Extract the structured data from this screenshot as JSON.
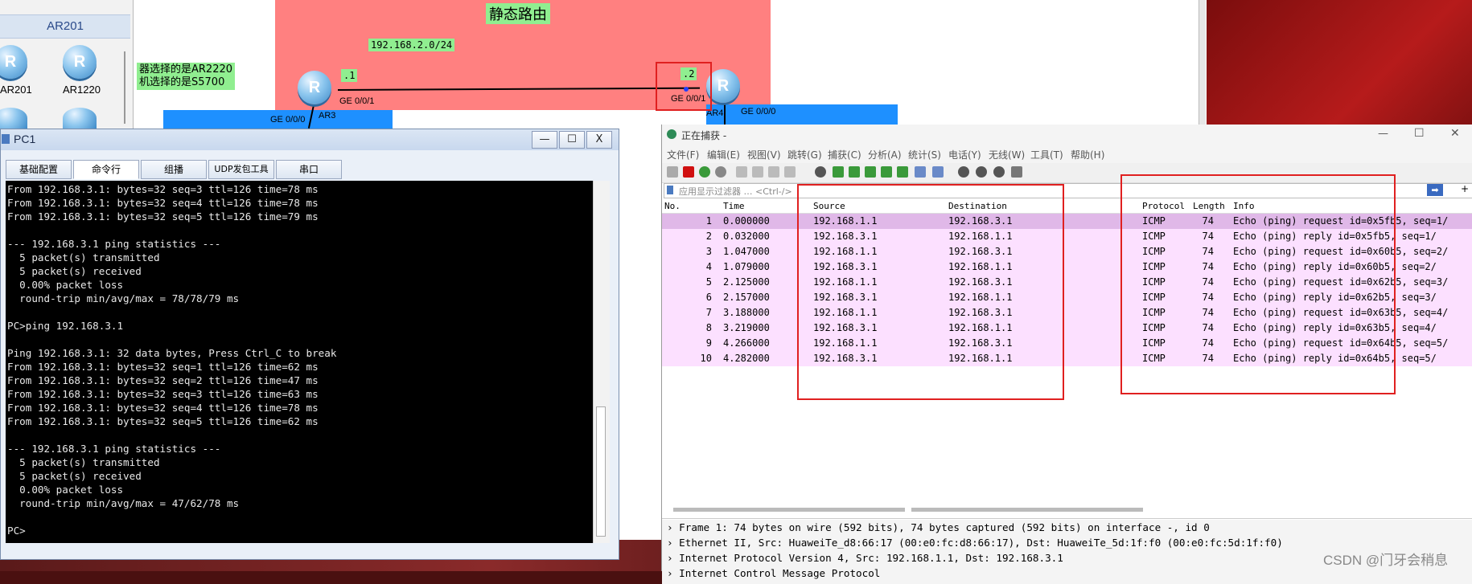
{
  "topology": {
    "device_panel_title": "AR201",
    "devices": [
      {
        "label": "AR201",
        "icon_letter": "R"
      },
      {
        "label": "AR1220",
        "icon_letter": "R"
      }
    ],
    "zone_title": "静态路由",
    "subnet_label": "192.168.2.0/24",
    "note_line1": "器选择的是AR2220",
    "note_line2": "机选择的是S5700",
    "ar3": {
      "label": "AR3",
      "icon_letter": "R",
      "port_right": "GE 0/0/1",
      "port_bottom": "GE 0/0/0",
      "ip_suffix": ".1"
    },
    "ar4": {
      "label": "AR4",
      "icon_letter": "R",
      "port_left": "GE 0/0/1",
      "port_bottom": "GE 0/0/0",
      "ip_suffix": ".2"
    },
    "colors": {
      "zone": "#ff8080",
      "link_area": "#1e90ff",
      "label_bg": "#90ee90",
      "highlight": "#e02020"
    }
  },
  "pc1": {
    "title": "PC1",
    "buttons": {
      "minimize": "—",
      "maximize": "☐",
      "close": "X"
    },
    "tabs": [
      "基础配置",
      "命令行",
      "组播",
      "UDP发包工具",
      "串口"
    ],
    "active_tab": 1,
    "console_text": "From 192.168.3.1: bytes=32 seq=3 ttl=126 time=78 ms\nFrom 192.168.3.1: bytes=32 seq=4 ttl=126 time=78 ms\nFrom 192.168.3.1: bytes=32 seq=5 ttl=126 time=79 ms\n\n--- 192.168.3.1 ping statistics ---\n  5 packet(s) transmitted\n  5 packet(s) received\n  0.00% packet loss\n  round-trip min/avg/max = 78/78/79 ms\n\nPC>ping 192.168.3.1\n\nPing 192.168.3.1: 32 data bytes, Press Ctrl_C to break\nFrom 192.168.3.1: bytes=32 seq=1 ttl=126 time=62 ms\nFrom 192.168.3.1: bytes=32 seq=2 ttl=126 time=47 ms\nFrom 192.168.3.1: bytes=32 seq=3 ttl=126 time=63 ms\nFrom 192.168.3.1: bytes=32 seq=4 ttl=126 time=78 ms\nFrom 192.168.3.1: bytes=32 seq=5 ttl=126 time=62 ms\n\n--- 192.168.3.1 ping statistics ---\n  5 packet(s) transmitted\n  5 packet(s) received\n  0.00% packet loss\n  round-trip min/avg/max = 47/62/78 ms\n\nPC>"
  },
  "wireshark": {
    "title": "正在捕获 -",
    "window_buttons": {
      "minimize": "—",
      "maximize": "☐",
      "close": "✕"
    },
    "menu": [
      "文件(F)",
      "编辑(E)",
      "视图(V)",
      "跳转(G)",
      "捕获(C)",
      "分析(A)",
      "统计(S)",
      "电话(Y)",
      "无线(W)",
      "工具(T)",
      "帮助(H)"
    ],
    "filter_placeholder": "应用显示过滤器 … <Ctrl-/>",
    "filter_apply": "➡",
    "filter_add": "+",
    "columns": [
      "No.",
      "Time",
      "Source",
      "Destination",
      "Protocol",
      "Length",
      "Info"
    ],
    "packets": [
      {
        "no": "1",
        "time": "0.000000",
        "src": "192.168.1.1",
        "dst": "192.168.3.1",
        "proto": "ICMP",
        "len": "74",
        "info": "Echo (ping) request  id=0x5fb5, seq=1/"
      },
      {
        "no": "2",
        "time": "0.032000",
        "src": "192.168.3.1",
        "dst": "192.168.1.1",
        "proto": "ICMP",
        "len": "74",
        "info": "Echo (ping) reply    id=0x5fb5, seq=1/"
      },
      {
        "no": "3",
        "time": "1.047000",
        "src": "192.168.1.1",
        "dst": "192.168.3.1",
        "proto": "ICMP",
        "len": "74",
        "info": "Echo (ping) request  id=0x60b5, seq=2/"
      },
      {
        "no": "4",
        "time": "1.079000",
        "src": "192.168.3.1",
        "dst": "192.168.1.1",
        "proto": "ICMP",
        "len": "74",
        "info": "Echo (ping) reply    id=0x60b5, seq=2/"
      },
      {
        "no": "5",
        "time": "2.125000",
        "src": "192.168.1.1",
        "dst": "192.168.3.1",
        "proto": "ICMP",
        "len": "74",
        "info": "Echo (ping) request  id=0x62b5, seq=3/"
      },
      {
        "no": "6",
        "time": "2.157000",
        "src": "192.168.3.1",
        "dst": "192.168.1.1",
        "proto": "ICMP",
        "len": "74",
        "info": "Echo (ping) reply    id=0x62b5, seq=3/"
      },
      {
        "no": "7",
        "time": "3.188000",
        "src": "192.168.1.1",
        "dst": "192.168.3.1",
        "proto": "ICMP",
        "len": "74",
        "info": "Echo (ping) request  id=0x63b5, seq=4/"
      },
      {
        "no": "8",
        "time": "3.219000",
        "src": "192.168.3.1",
        "dst": "192.168.1.1",
        "proto": "ICMP",
        "len": "74",
        "info": "Echo (ping) reply    id=0x63b5, seq=4/"
      },
      {
        "no": "9",
        "time": "4.266000",
        "src": "192.168.1.1",
        "dst": "192.168.3.1",
        "proto": "ICMP",
        "len": "74",
        "info": "Echo (ping) request  id=0x64b5, seq=5/"
      },
      {
        "no": "10",
        "time": "4.282000",
        "src": "192.168.3.1",
        "dst": "192.168.1.1",
        "proto": "ICMP",
        "len": "74",
        "info": "Echo (ping) reply    id=0x64b5, seq=5/"
      }
    ],
    "details": [
      "›  Frame 1: 74 bytes on wire (592 bits), 74 bytes captured (592 bits) on interface -, id 0",
      "›  Ethernet II, Src: HuaweiTe_d8:66:17 (00:e0:fc:d8:66:17), Dst: HuaweiTe_5d:1f:f0 (00:e0:fc:5d:1f:f0)",
      "›  Internet Protocol Version 4, Src: 192.168.1.1, Dst: 192.168.3.1",
      "›  Internet Control Message Protocol"
    ],
    "colors": {
      "row_bg": "#fce0ff",
      "row_selected": "#e0b8e8"
    }
  },
  "watermark": "CSDN @门牙会稍息"
}
